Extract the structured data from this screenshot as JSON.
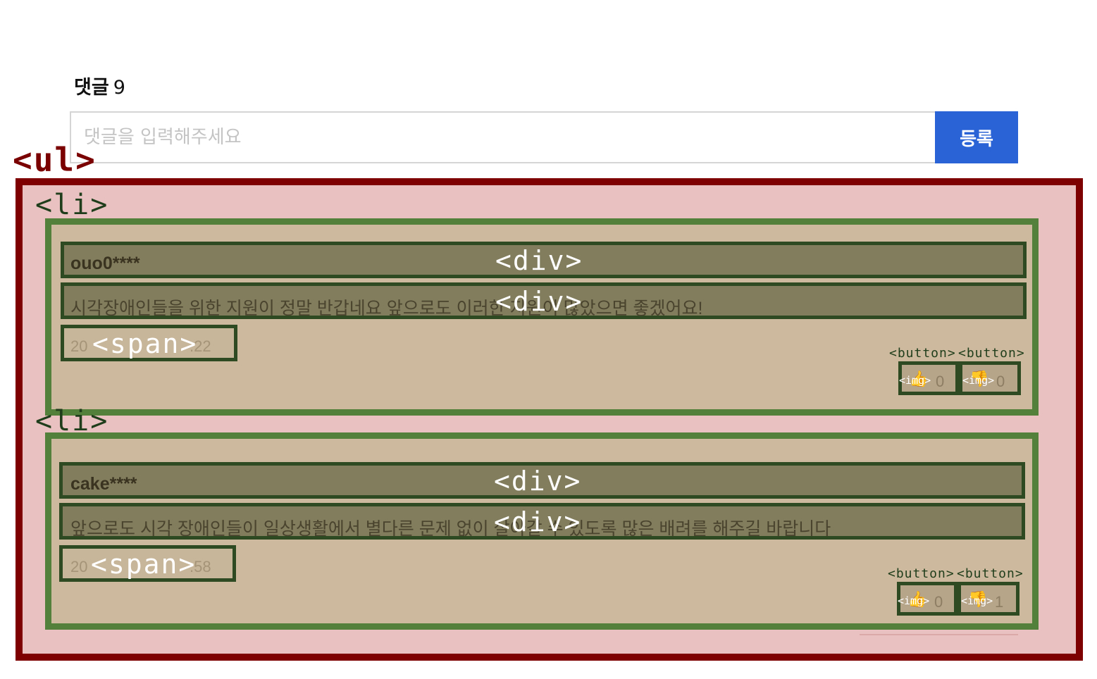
{
  "comments": {
    "title": "댓글",
    "count": "9",
    "input_placeholder": "댓글을 입력해주세요",
    "submit_label": "등록",
    "items": [
      {
        "user": "ouo0****",
        "text": "시각장애인들을 위한 지원이 정말 반갑네요 앞으로도 이러한 지원이 많았으면 좋겠어요!",
        "date_left": "20",
        "date_right": ".22",
        "like_count": "0",
        "dislike_count": "0"
      },
      {
        "user": "cake****",
        "text": "앞으로도 시각 장애인들이 일상생활에서 별다른 문제 없이 살아갈 수 있도록 많은 배려를 해주길 바랍니다",
        "date_left": "20",
        "date_right": ".58",
        "like_count": "0",
        "dislike_count": "1"
      }
    ]
  },
  "overlay": {
    "ul_tag": "<ul>",
    "li_tag": "<li>",
    "div_tag": "<div>",
    "span_tag": "<span>",
    "button_tag": "<button>",
    "img_tag": "<img>"
  },
  "colors": {
    "submit_button": "#2a63d6",
    "ul_border": "#7f0000",
    "li_border": "#53803a",
    "div_border": "#2e4a23"
  }
}
